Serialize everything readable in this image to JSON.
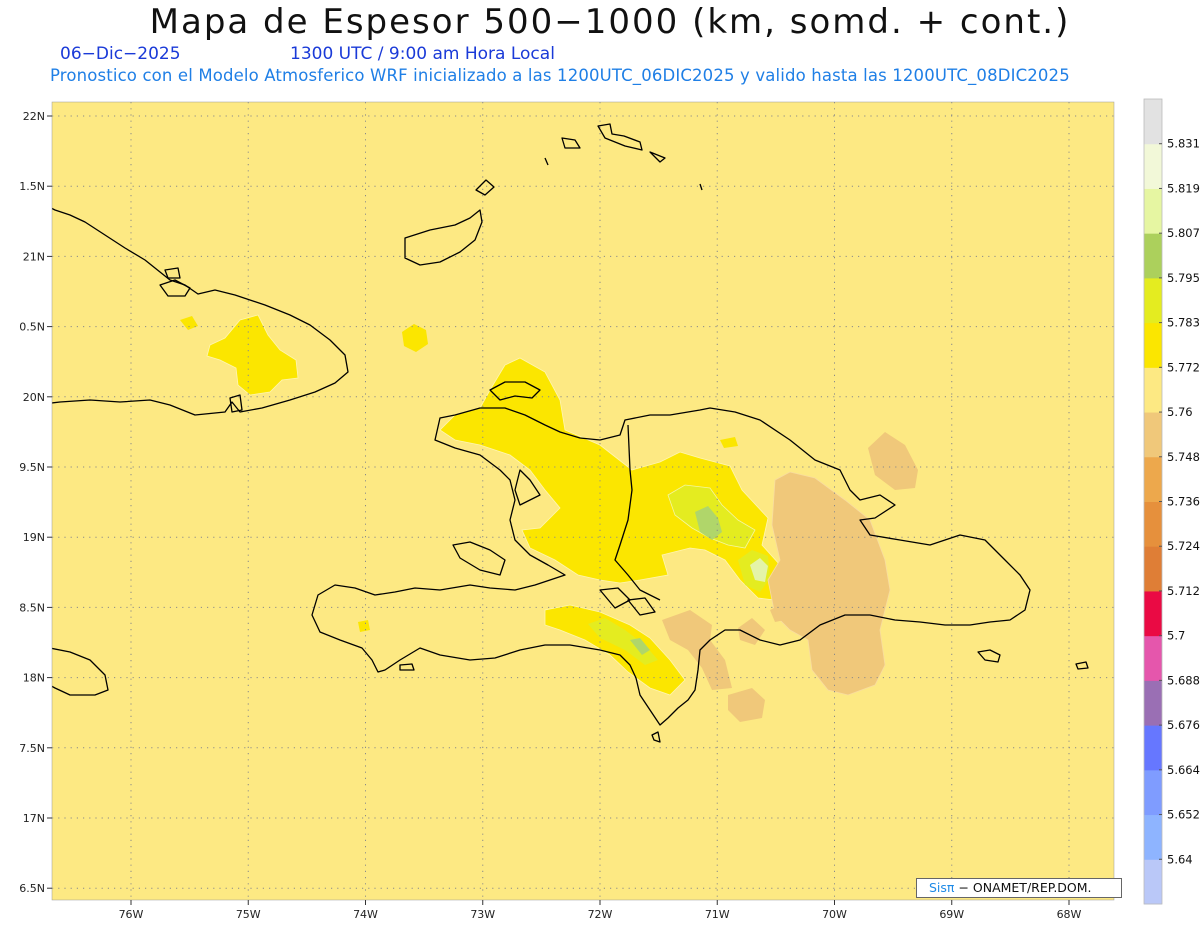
{
  "header": {
    "title": "Mapa de Espesor 500−1000 (km, somd. + cont.)",
    "date": "06−Dic−2025",
    "time": "1300 UTC / 9:00 am Hora Local",
    "description": "Pronostico con el Modelo Atmosferico WRF inicializado a las 1200UTC_06DIC2025 y valido hasta las  1200UTC_08DIC2025"
  },
  "map": {
    "lat_labels": [
      "22N",
      "1.5N",
      "21N",
      "0.5N",
      "20N",
      "9.5N",
      "19N",
      "8.5N",
      "18N",
      "7.5N",
      "17N",
      "6.5N"
    ],
    "lon_labels": [
      "76W",
      "75W",
      "74W",
      "73W",
      "72W",
      "71W",
      "70W",
      "69W",
      "68W"
    ],
    "grid": true,
    "background_color": "#fde983",
    "fill_colors": {
      "c5760": "#fde983",
      "c5748": "#f0c87a",
      "c5772": "#fbe600",
      "c5783": "#e4ec20",
      "c5795": "#b0d66a",
      "c5807": "#e4f4a8"
    }
  },
  "colorbar": {
    "labels": [
      "5.831",
      "5.819",
      "5.807",
      "5.795",
      "5.783",
      "5.772",
      "5.76",
      "5.748",
      "5.736",
      "5.724",
      "5.712",
      "5.7",
      "5.688",
      "5.676",
      "5.664",
      "5.652",
      "5.64"
    ],
    "colors": [
      "#bac8f8",
      "#8eb4ff",
      "#7f9cff",
      "#6677ff",
      "#9a6fb4",
      "#e556ac",
      "#ea0a44",
      "#df7e36",
      "#e6903c",
      "#eda84c",
      "#f0c87a",
      "#fde983",
      "#fbe600",
      "#e4ec20",
      "#acd05c",
      "#e6f6a2",
      "#f2f8d8",
      "#e2e2e2"
    ]
  },
  "credit": {
    "sis": "Sisπ",
    "text": "− ONAMET/REP.DOM."
  }
}
